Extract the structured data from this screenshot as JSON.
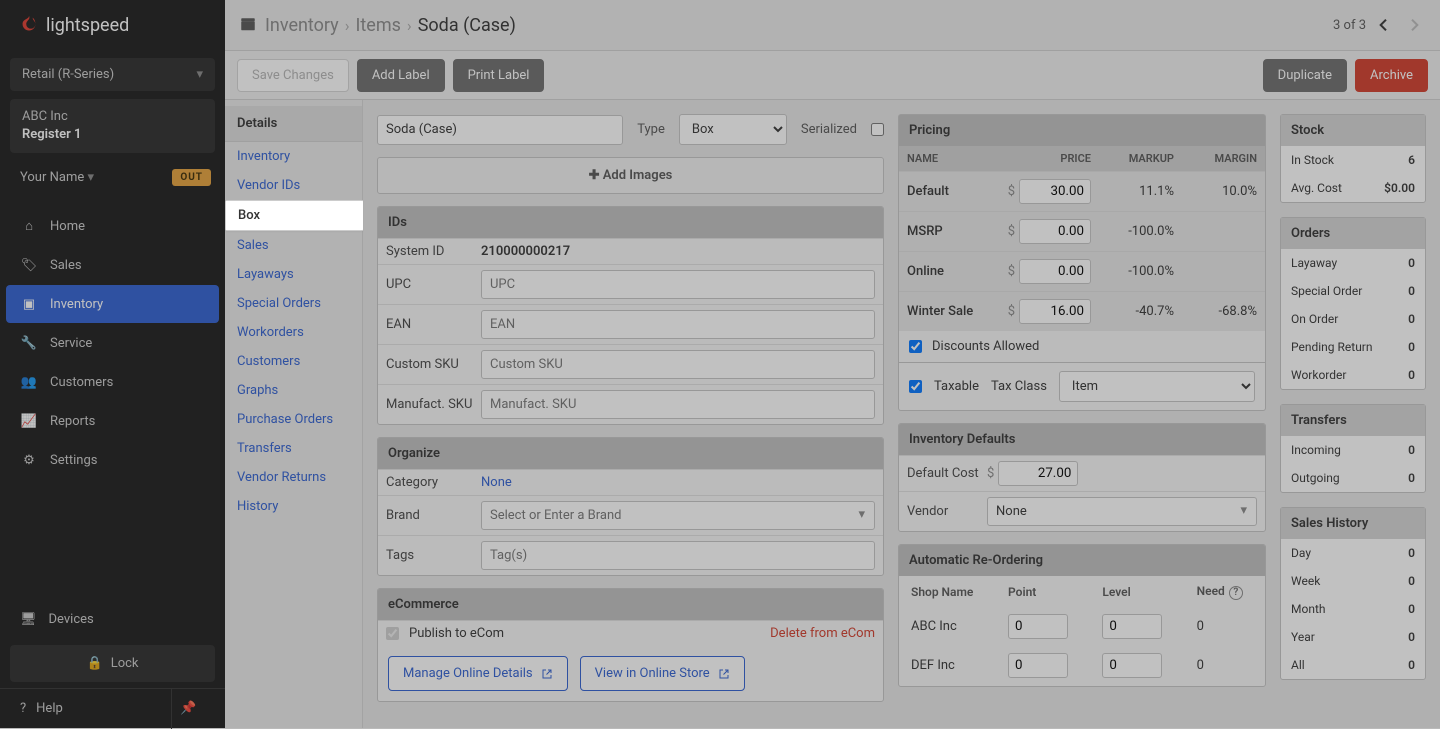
{
  "brand": "lightspeed",
  "brand_color": "#e03a2f",
  "register_selector": "Retail (R-Series)",
  "company": {
    "name": "ABC Inc",
    "register": "Register 1"
  },
  "user": {
    "name": "Your Name",
    "badge": "OUT"
  },
  "nav": [
    {
      "label": "Home",
      "icon": "home"
    },
    {
      "label": "Sales",
      "icon": "tag"
    },
    {
      "label": "Inventory",
      "icon": "box",
      "active": true
    },
    {
      "label": "Service",
      "icon": "wrench"
    },
    {
      "label": "Customers",
      "icon": "users"
    },
    {
      "label": "Reports",
      "icon": "chart"
    },
    {
      "label": "Settings",
      "icon": "gear"
    }
  ],
  "devices_label": "Devices",
  "lock_label": "Lock",
  "help_label": "Help",
  "breadcrumb": {
    "l1": "Inventory",
    "l2": "Items",
    "current": "Soda (Case)",
    "pager": "3 of 3"
  },
  "actions": {
    "save": "Save Changes",
    "add_label": "Add Label",
    "print_label": "Print Label",
    "duplicate": "Duplicate",
    "archive": "Archive"
  },
  "subnav": {
    "heading": "Details",
    "items": [
      "Inventory",
      "Vendor IDs",
      "Box",
      "Sales",
      "Layaways",
      "Special Orders",
      "Workorders",
      "Customers",
      "Graphs",
      "Purchase Orders",
      "Transfers",
      "Vendor Returns",
      "History"
    ],
    "selected_index": 2
  },
  "name_field": {
    "value": "Soda (Case)"
  },
  "type": {
    "label": "Type",
    "value": "Box"
  },
  "serialized_label": "Serialized",
  "add_images_label": "Add Images",
  "ids": {
    "title": "IDs",
    "rows": [
      {
        "label": "System ID",
        "value": "210000000217",
        "readonly": true
      },
      {
        "label": "UPC",
        "placeholder": "UPC"
      },
      {
        "label": "EAN",
        "placeholder": "EAN"
      },
      {
        "label": "Custom SKU",
        "placeholder": "Custom SKU"
      },
      {
        "label": "Manufact. SKU",
        "placeholder": "Manufact. SKU"
      }
    ]
  },
  "organize": {
    "title": "Organize",
    "category_label": "Category",
    "category_value": "None",
    "brand_label": "Brand",
    "brand_placeholder": "Select or Enter a Brand",
    "tags_label": "Tags",
    "tags_placeholder": "Tag(s)"
  },
  "ecom": {
    "title": "eCommerce",
    "publish_label": "Publish to eCom",
    "publish_checked": true,
    "delete_label": "Delete from eCom",
    "manage_label": "Manage Online Details",
    "view_label": "View in Online Store"
  },
  "pricing": {
    "title": "Pricing",
    "headers": [
      "NAME",
      "PRICE",
      "MARKUP",
      "MARGIN"
    ],
    "rows": [
      {
        "name": "Default",
        "price": "30.00",
        "markup": "11.1%",
        "margin": "10.0%"
      },
      {
        "name": "MSRP",
        "price": "0.00",
        "markup": "-100.0%",
        "margin": ""
      },
      {
        "name": "Online",
        "price": "0.00",
        "markup": "-100.0%",
        "margin": ""
      },
      {
        "name": "Winter Sale",
        "price": "16.00",
        "markup": "-40.7%",
        "margin": "-68.8%"
      }
    ],
    "discounts_label": "Discounts Allowed",
    "discounts_checked": true,
    "taxable_label": "Taxable",
    "taxable_checked": true,
    "tax_class_label": "Tax Class",
    "tax_class_value": "Item"
  },
  "inv_defaults": {
    "title": "Inventory Defaults",
    "default_cost_label": "Default Cost",
    "default_cost_value": "27.00",
    "vendor_label": "Vendor",
    "vendor_value": "None"
  },
  "auto_reorder": {
    "title": "Automatic Re-Ordering",
    "headers": [
      "Shop Name",
      "Point",
      "Level",
      "Need"
    ],
    "rows": [
      {
        "shop": "ABC Inc",
        "point": "0",
        "level": "0",
        "need": "0"
      },
      {
        "shop": "DEF Inc",
        "point": "0",
        "level": "0",
        "need": "0"
      }
    ]
  },
  "stock": {
    "title": "Stock",
    "in_stock_label": "In Stock",
    "in_stock": "6",
    "avg_cost_label": "Avg. Cost",
    "avg_cost": "$0.00"
  },
  "orders": {
    "title": "Orders",
    "rows": [
      {
        "label": "Layaway",
        "value": "0"
      },
      {
        "label": "Special Order",
        "value": "0"
      },
      {
        "label": "On Order",
        "value": "0"
      },
      {
        "label": "Pending Return",
        "value": "0"
      },
      {
        "label": "Workorder",
        "value": "0"
      }
    ]
  },
  "transfers": {
    "title": "Transfers",
    "rows": [
      {
        "label": "Incoming",
        "value": "0"
      },
      {
        "label": "Outgoing",
        "value": "0"
      }
    ]
  },
  "sales_history": {
    "title": "Sales History",
    "rows": [
      {
        "label": "Day",
        "value": "0"
      },
      {
        "label": "Week",
        "value": "0"
      },
      {
        "label": "Month",
        "value": "0"
      },
      {
        "label": "Year",
        "value": "0"
      },
      {
        "label": "All",
        "value": "0"
      }
    ]
  }
}
